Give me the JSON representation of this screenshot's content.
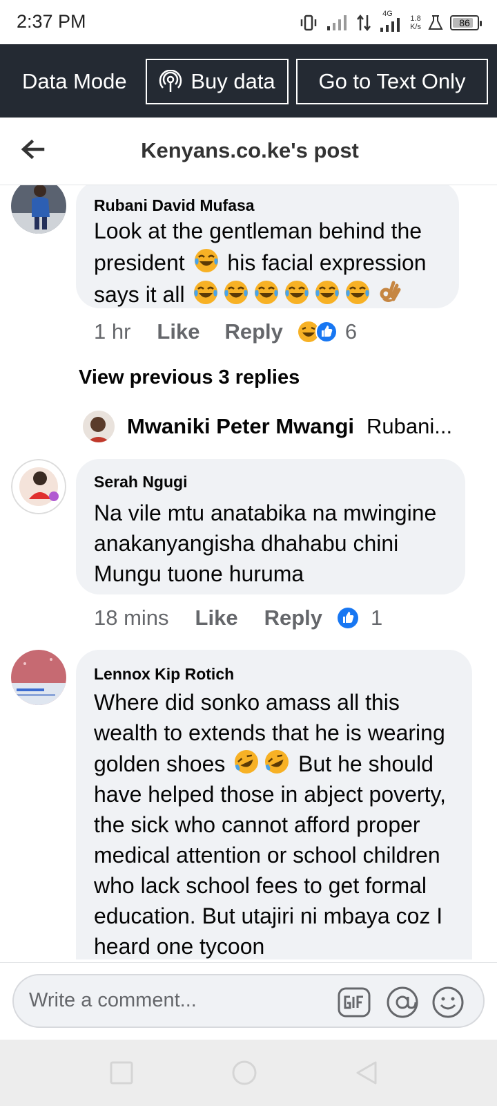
{
  "status_bar": {
    "time": "2:37 PM",
    "network": "4G",
    "speed_value": "1.8",
    "speed_unit": "K/s",
    "battery": "86",
    "battery_level": 0.86
  },
  "data_bar": {
    "mode_label": "Data Mode",
    "buy_label": "Buy data",
    "text_only_label": "Go to Text Only"
  },
  "header": {
    "title": "Kenyans.co.ke's post"
  },
  "comments": [
    {
      "author": "Rubani David Mufasa",
      "text_parts": [
        "Look at the gentleman behind the president ",
        " his facial expression says it all "
      ],
      "time": "1 hr",
      "like": "Like",
      "reply": "Reply",
      "reaction_count": "6"
    },
    {
      "author": "Serah Ngugi",
      "text": "Na vile mtu anatabika na mwingine anakanyangisha dhahabu chini Mungu tuone huruma",
      "time": "18 mins",
      "like": "Like",
      "reply": "Reply",
      "reaction_count": "1"
    },
    {
      "author": "Lennox Kip Rotich",
      "text_parts": [
        "Where did sonko amass all this wealth to extends that he is wearing golden shoes ",
        " But he should have helped those in abject poverty, the sick who cannot afford proper medical attention or school children who lack school fees to get formal education. But utajiri ni mbaya coz I heard one tycoon"
      ]
    }
  ],
  "view_previous": "View previous 3 replies",
  "reply_preview": {
    "author": "Mwaniki Peter Mwangi",
    "text": "Rubani..."
  },
  "composer": {
    "placeholder": "Write a comment..."
  },
  "icons": {
    "back": "arrow-left-icon",
    "buy": "radio-tower-icon",
    "gif": "gif-icon",
    "mention": "at-icon",
    "emoji": "smiley-icon",
    "recents": "square-icon",
    "home": "circle-icon",
    "back_nav": "triangle-icon"
  },
  "colors": {
    "data_bar_bg": "#242a33",
    "bubble_bg": "#f0f2f5",
    "like_blue": "#1877f2",
    "laugh_yellow": "#f7b125"
  }
}
